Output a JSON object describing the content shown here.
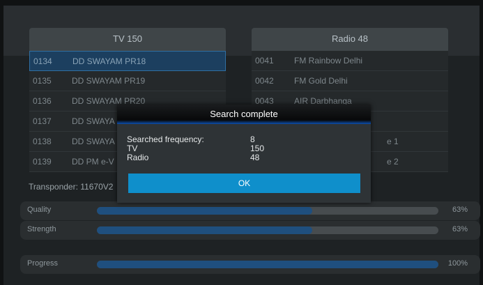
{
  "tv_list": {
    "header": "TV 150",
    "rows": [
      {
        "num": "0134",
        "name": "DD SWAYAM PR18",
        "selected": true
      },
      {
        "num": "0135",
        "name": "DD SWAYAM PR19"
      },
      {
        "num": "0136",
        "name": "DD SWAYAM PR20"
      },
      {
        "num": "0137",
        "name": "DD SWAYA"
      },
      {
        "num": "0138",
        "name": "DD SWAYA"
      },
      {
        "num": "0139",
        "name": "DD PM e-V"
      }
    ]
  },
  "radio_list": {
    "header": "Radio 48",
    "rows": [
      {
        "num": "0041",
        "name": "FM Rainbow Delhi"
      },
      {
        "num": "0042",
        "name": "FM Gold Delhi"
      },
      {
        "num": "0043",
        "name": "AIR Darbhanga"
      },
      {
        "num": "",
        "name": ""
      },
      {
        "num": "",
        "name": "e 1"
      },
      {
        "num": "",
        "name": "e 2"
      }
    ]
  },
  "transponder": "Transponder: 11670V2",
  "meters": {
    "quality": {
      "label": "Quality",
      "value": 63,
      "text": "63%"
    },
    "strength": {
      "label": "Strength",
      "value": 63,
      "text": "63%"
    },
    "progress": {
      "label": "Progress",
      "value": 100,
      "text": "100%"
    }
  },
  "dialog": {
    "title": "Search complete",
    "rows": [
      {
        "key": "Searched frequency:",
        "value": "8"
      },
      {
        "key": "TV",
        "value": "150"
      },
      {
        "key": "Radio",
        "value": "48"
      }
    ],
    "ok_label": "OK"
  },
  "colors": {
    "accent": "#0f8fcb",
    "bar_fill": "#1f4f7e"
  }
}
